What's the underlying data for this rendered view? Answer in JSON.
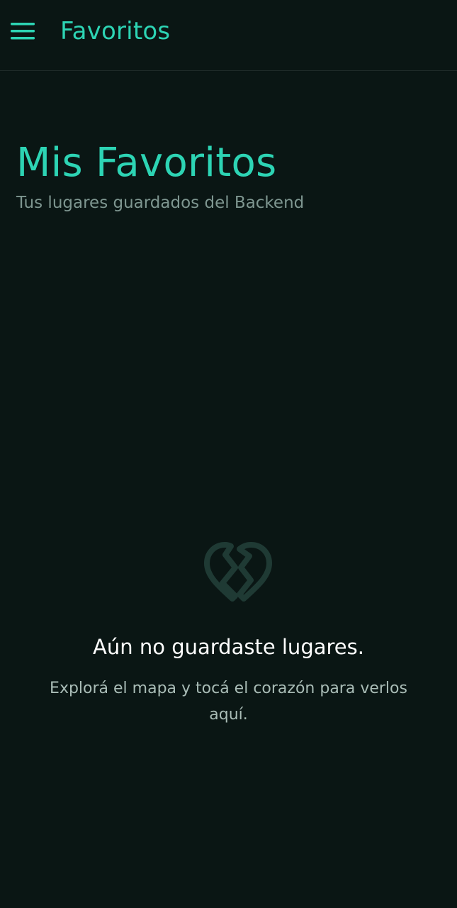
{
  "app_bar": {
    "title": "Favoritos",
    "menu_icon": "hamburger-menu-icon"
  },
  "header": {
    "title": "Mis Favoritos",
    "subtitle": "Tus lugares guardados del Backend"
  },
  "empty_state": {
    "icon": "broken-heart-icon",
    "title": "Aún no guardaste lugares.",
    "description": "Explorá el mapa y tocá el corazón para verlos aquí."
  },
  "colors": {
    "background": "#0a1614",
    "accent": "#2dd4b4",
    "muted_text": "#7e9690",
    "icon_muted": "#1f3a34"
  }
}
